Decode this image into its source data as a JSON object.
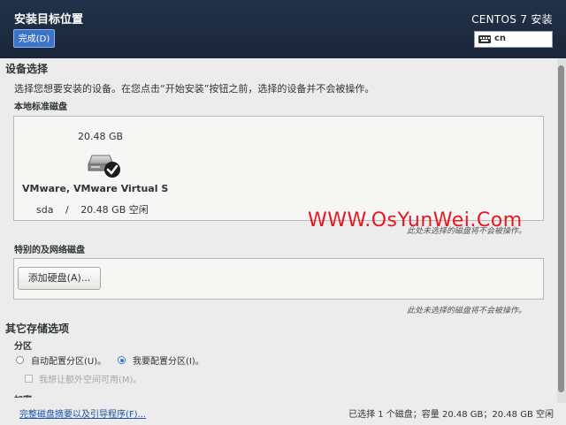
{
  "header": {
    "title": "安装目标位置",
    "done_button": "完成(D)",
    "product": "CENTOS 7 安装",
    "keyboard_layout": "cn"
  },
  "device_selection": {
    "title": "设备选择",
    "description": "选择您想要安装的设备。在您点击“开始安装”按钮之前，选择的设备并不会被操作。",
    "local_disks_title": "本地标准磁盘",
    "disk": {
      "size": "20.48 GB",
      "name": "VMware, VMware Virtual S",
      "device": "sda",
      "separator": "/",
      "free": "20.48 GB 空闲",
      "selected": true
    },
    "local_note": "此处未选择的磁盘将不会被操作。"
  },
  "watermark": "WWW.OsYunWei.Com",
  "special_disks": {
    "title": "特别的及网络磁盘",
    "add_button": "添加硬盘(A)...",
    "note": "此处未选择的磁盘将不会被操作。"
  },
  "other_options": {
    "title": "其它存储选项",
    "partitioning_title": "分区",
    "auto_partition": "自动配置分区(U)。",
    "manual_partition": "我要配置分区(I)。",
    "extra_space": "我想让额外空间可用(M)。",
    "encryption_title": "加密"
  },
  "footer": {
    "summary_link": "完整磁盘摘要以及引导程序(F)...",
    "summary": "已选择 1 个磁盘；容量 20.48 GB；20.48 GB 空闲"
  },
  "colors": {
    "header_bg": "#1e2b3f",
    "accent": "#3b73c9",
    "watermark": "#e8171f"
  }
}
